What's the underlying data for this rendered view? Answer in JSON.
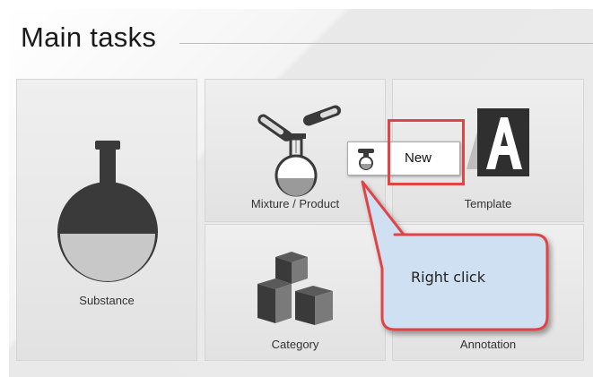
{
  "panel": {
    "title": "Main tasks"
  },
  "tiles": {
    "substance": {
      "label": "Substance"
    },
    "mixture": {
      "label": "Mixture / Product"
    },
    "template": {
      "label": "Template"
    },
    "category": {
      "label": "Category"
    },
    "annotation": {
      "label": "Annotation"
    }
  },
  "context_menu": {
    "new_label": "New"
  },
  "callout": {
    "text": "Right click"
  },
  "colors": {
    "highlight": "#e04444",
    "callout_fill": "#cfe0f3",
    "icon": "#3a3a3a"
  },
  "icons": [
    "flask-icon",
    "mixture-icon",
    "template-icon",
    "category-icon",
    "new-icon"
  ]
}
